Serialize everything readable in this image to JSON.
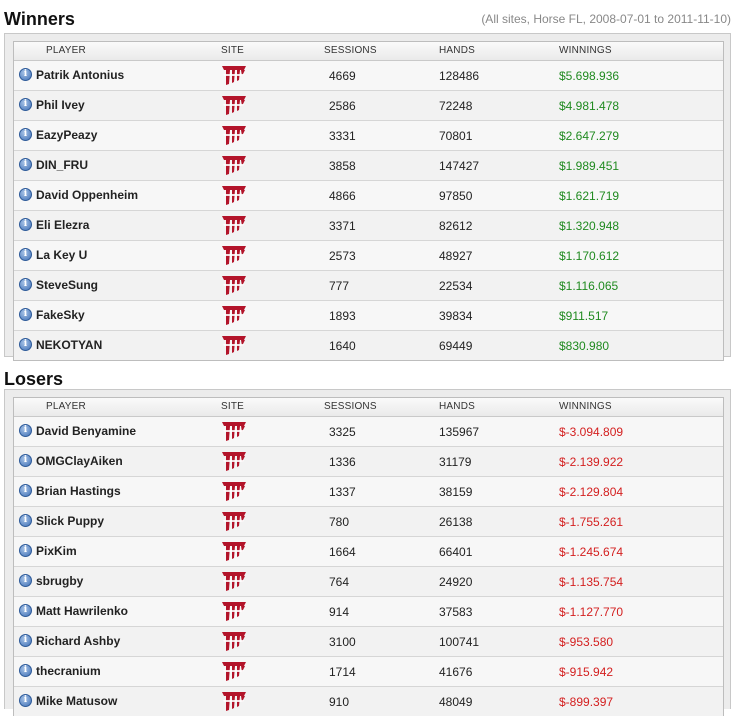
{
  "subtitle": "(All sites, Horse FL, 2008-07-01 to 2011-11-10)",
  "columns": {
    "player": "PLAYER",
    "site": "SITE",
    "sessions": "SESSIONS",
    "hands": "HANDS",
    "winnings": "WINNINGS"
  },
  "colors": {
    "positive": "#1f8a1f",
    "negative": "#d42020",
    "site_logo": "#b3142a"
  },
  "site_icon": "full-tilt-poker-logo-icon",
  "winners": {
    "title": "Winners",
    "rows": [
      {
        "player": "Patrik Antonius",
        "sessions": "4669",
        "hands": "128486",
        "winnings": "$5.698.936"
      },
      {
        "player": "Phil Ivey",
        "sessions": "2586",
        "hands": "72248",
        "winnings": "$4.981.478"
      },
      {
        "player": "EazyPeazy",
        "sessions": "3331",
        "hands": "70801",
        "winnings": "$2.647.279"
      },
      {
        "player": "DIN_FRU",
        "sessions": "3858",
        "hands": "147427",
        "winnings": "$1.989.451"
      },
      {
        "player": "David Oppenheim",
        "sessions": "4866",
        "hands": "97850",
        "winnings": "$1.621.719"
      },
      {
        "player": "Eli Elezra",
        "sessions": "3371",
        "hands": "82612",
        "winnings": "$1.320.948"
      },
      {
        "player": "La Key U",
        "sessions": "2573",
        "hands": "48927",
        "winnings": "$1.170.612"
      },
      {
        "player": "SteveSung",
        "sessions": "777",
        "hands": "22534",
        "winnings": "$1.116.065"
      },
      {
        "player": "FakeSky",
        "sessions": "1893",
        "hands": "39834",
        "winnings": "$911.517"
      },
      {
        "player": "NEKOTYAN",
        "sessions": "1640",
        "hands": "69449",
        "winnings": "$830.980"
      }
    ]
  },
  "losers": {
    "title": "Losers",
    "rows": [
      {
        "player": "David Benyamine",
        "sessions": "3325",
        "hands": "135967",
        "winnings": "$-3.094.809"
      },
      {
        "player": "OMGClayAiken",
        "sessions": "1336",
        "hands": "31179",
        "winnings": "$-2.139.922"
      },
      {
        "player": "Brian Hastings",
        "sessions": "1337",
        "hands": "38159",
        "winnings": "$-2.129.804"
      },
      {
        "player": "Slick Puppy",
        "sessions": "780",
        "hands": "26138",
        "winnings": "$-1.755.261"
      },
      {
        "player": "PixKim",
        "sessions": "1664",
        "hands": "66401",
        "winnings": "$-1.245.674"
      },
      {
        "player": "sbrugby",
        "sessions": "764",
        "hands": "24920",
        "winnings": "$-1.135.754"
      },
      {
        "player": "Matt Hawrilenko",
        "sessions": "914",
        "hands": "37583",
        "winnings": "$-1.127.770"
      },
      {
        "player": "Richard Ashby",
        "sessions": "3100",
        "hands": "100741",
        "winnings": "$-953.580"
      },
      {
        "player": "thecranium",
        "sessions": "1714",
        "hands": "41676",
        "winnings": "$-915.942"
      },
      {
        "player": "Mike Matusow",
        "sessions": "910",
        "hands": "48049",
        "winnings": "$-899.397"
      }
    ]
  }
}
